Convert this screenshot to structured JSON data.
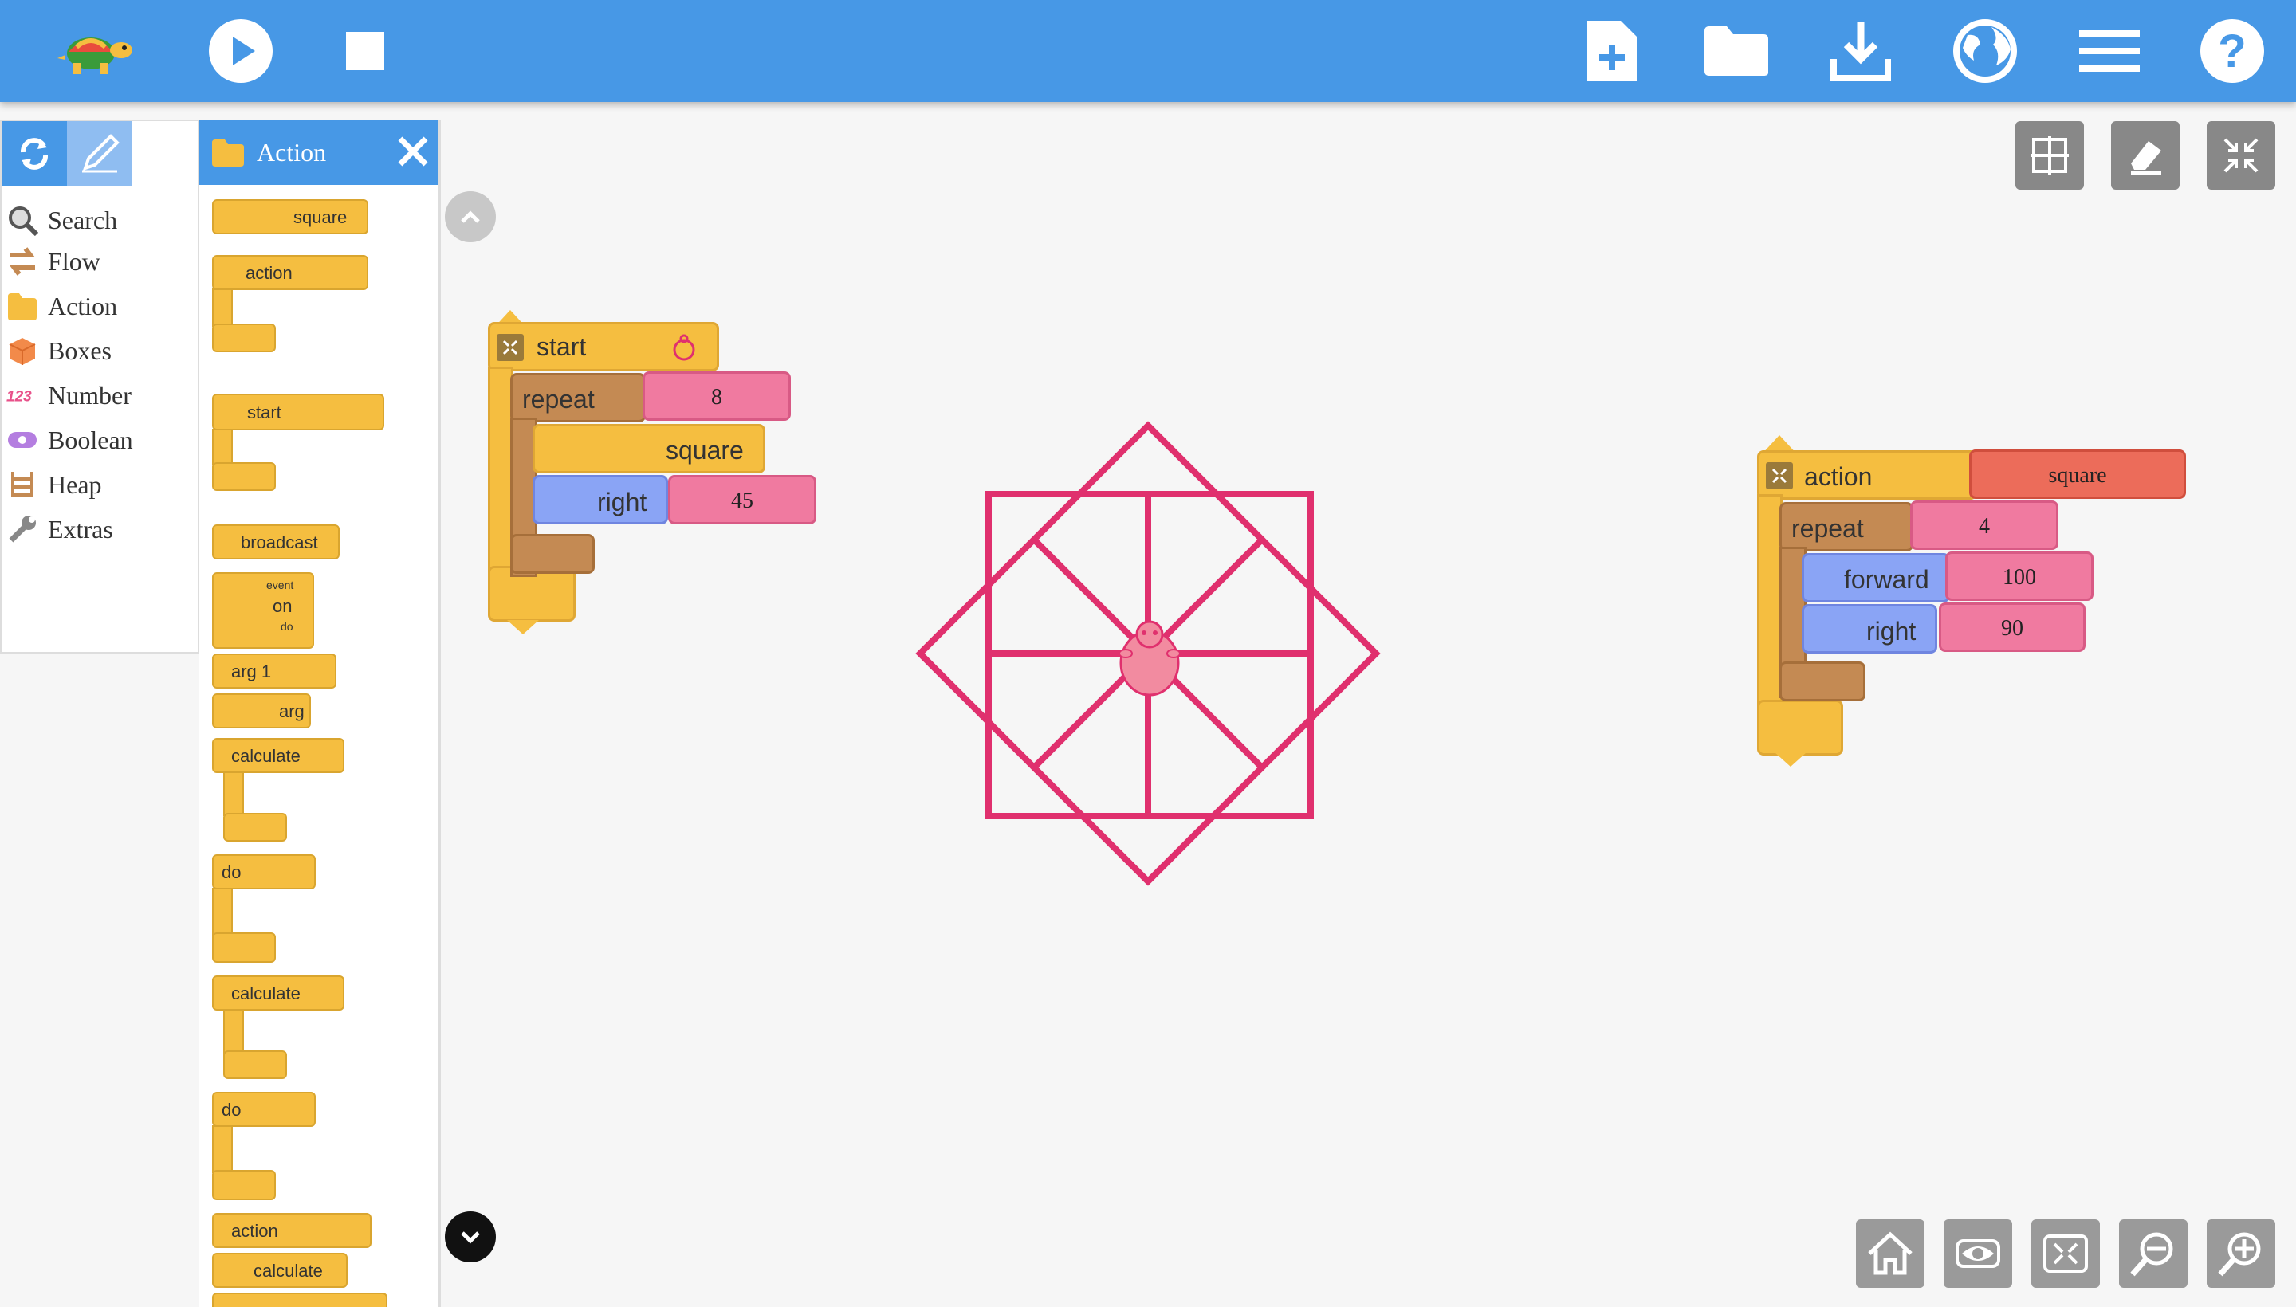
{
  "toolbar": {
    "icons": [
      "turtle-logo",
      "play-icon",
      "stop-icon",
      "new-file-icon",
      "open-folder-icon",
      "download-icon",
      "globe-icon",
      "menu-icon",
      "help-icon"
    ]
  },
  "palette_selector": {
    "items": [
      {
        "label": "Search",
        "icon": "search-icon"
      },
      {
        "label": "Flow",
        "icon": "flow-icon"
      },
      {
        "label": "Action",
        "icon": "action-icon"
      },
      {
        "label": "Boxes",
        "icon": "boxes-icon"
      },
      {
        "label": "Number",
        "icon": "number-icon"
      },
      {
        "label": "Boolean",
        "icon": "boolean-icon"
      },
      {
        "label": "Heap",
        "icon": "heap-icon"
      },
      {
        "label": "Extras",
        "icon": "extras-icon"
      }
    ]
  },
  "palette": {
    "title": "Action",
    "blocks": [
      "square",
      "action",
      "start",
      "broadcast",
      "event",
      "on",
      "do",
      "arg 1",
      "arg",
      "calculate",
      "do",
      "calculate",
      "do",
      "action",
      "calculate"
    ]
  },
  "start_stack": {
    "hat": "start",
    "repeat_label": "repeat",
    "repeat_count": "8",
    "call_label": "square",
    "right_label": "right",
    "right_value": "45"
  },
  "action_stack": {
    "hat": "action",
    "name": "square",
    "repeat_label": "repeat",
    "repeat_count": "4",
    "forward_label": "forward",
    "forward_value": "100",
    "right_label": "right",
    "right_value": "90"
  },
  "colors": {
    "toolbar": "#4798e6",
    "flow": "#c48a53",
    "action": "#f5be40",
    "pen_line": "#e0306e",
    "number": "#f07aa0",
    "turtle": "#f28ba0"
  }
}
